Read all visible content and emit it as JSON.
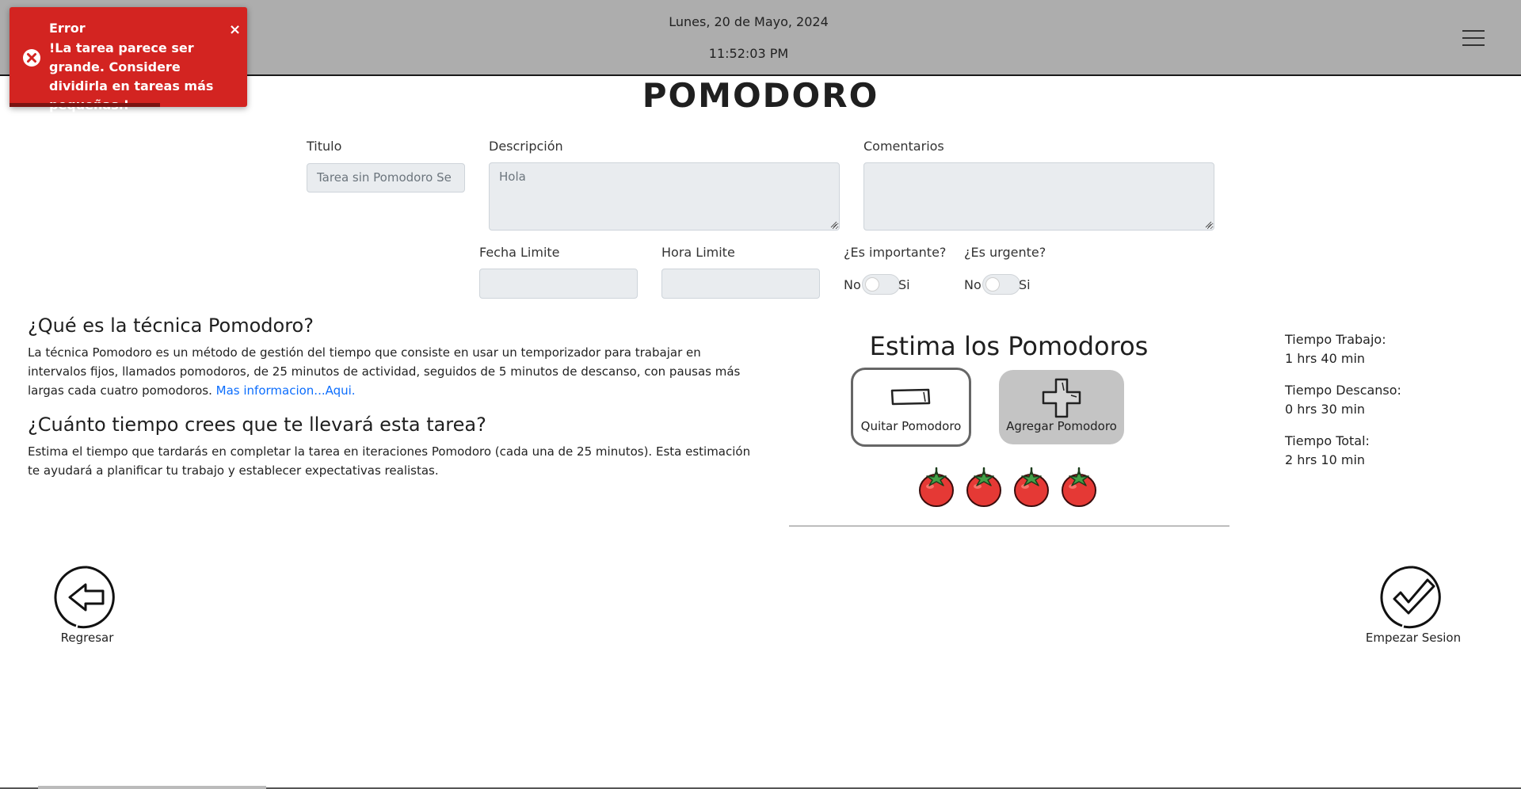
{
  "header": {
    "date": "Lunes, 20 de Mayo, 2024",
    "time": "11:52:03 PM"
  },
  "toast": {
    "title": "Error",
    "message": "!La tarea parece ser grande. Considere dividirla en tareas más pequeñas.!",
    "close": "×",
    "color": "#d32421"
  },
  "page_title": "POMODORO",
  "form": {
    "titulo_label": "Titulo",
    "titulo_value": "Tarea sin Pomodoro Se",
    "descripcion_label": "Descripción",
    "descripcion_value": "Hola",
    "comentarios_label": "Comentarios",
    "comentarios_value": "",
    "fecha_label": "Fecha Limite",
    "fecha_value": "",
    "hora_label": "Hora Limite",
    "hora_value": "",
    "importante_label": "¿Es importante?",
    "urgente_label": "¿Es urgente?",
    "toggle_no": "No",
    "toggle_si": "Si"
  },
  "info": {
    "q1_title": "¿Qué es la técnica Pomodoro?",
    "q1_text": "La técnica Pomodoro es un método de gestión del tiempo que consiste en usar un temporizador para trabajar en intervalos fijos, llamados pomodoros, de 25 minutos de actividad, seguidos de 5 minutos de descanso, con pausas más largas cada cuatro pomodoros.",
    "q1_link": "Mas informacion...Aqui.",
    "q2_title": "¿Cuánto tiempo crees que te llevará esta tarea?",
    "q2_text": "Estima el tiempo que tardarás en completar la tarea en iteraciones Pomodoro (cada una de 25 minutos). Esta estimación te ayudará a planificar tu trabajo y establecer expectativas realistas."
  },
  "estimate": {
    "title": "Estima los Pomodoros",
    "quitar_label": "Quitar Pomodoro",
    "agregar_label": "Agregar Pomodoro",
    "count": 4
  },
  "stats": {
    "trabajo_label": "Tiempo Trabajo:",
    "trabajo_value": "1 hrs 40 min",
    "descanso_label": "Tiempo Descanso:",
    "descanso_value": "0 hrs 30 min",
    "total_label": "Tiempo Total:",
    "total_value": "2 hrs 10 min"
  },
  "nav": {
    "back_label": "Regresar",
    "start_label": "Empezar Sesion"
  },
  "colors": {
    "topbar": "#adadad",
    "link": "#0d6efd",
    "tomato": "#e53935",
    "field_bg": "#e9ecef"
  }
}
